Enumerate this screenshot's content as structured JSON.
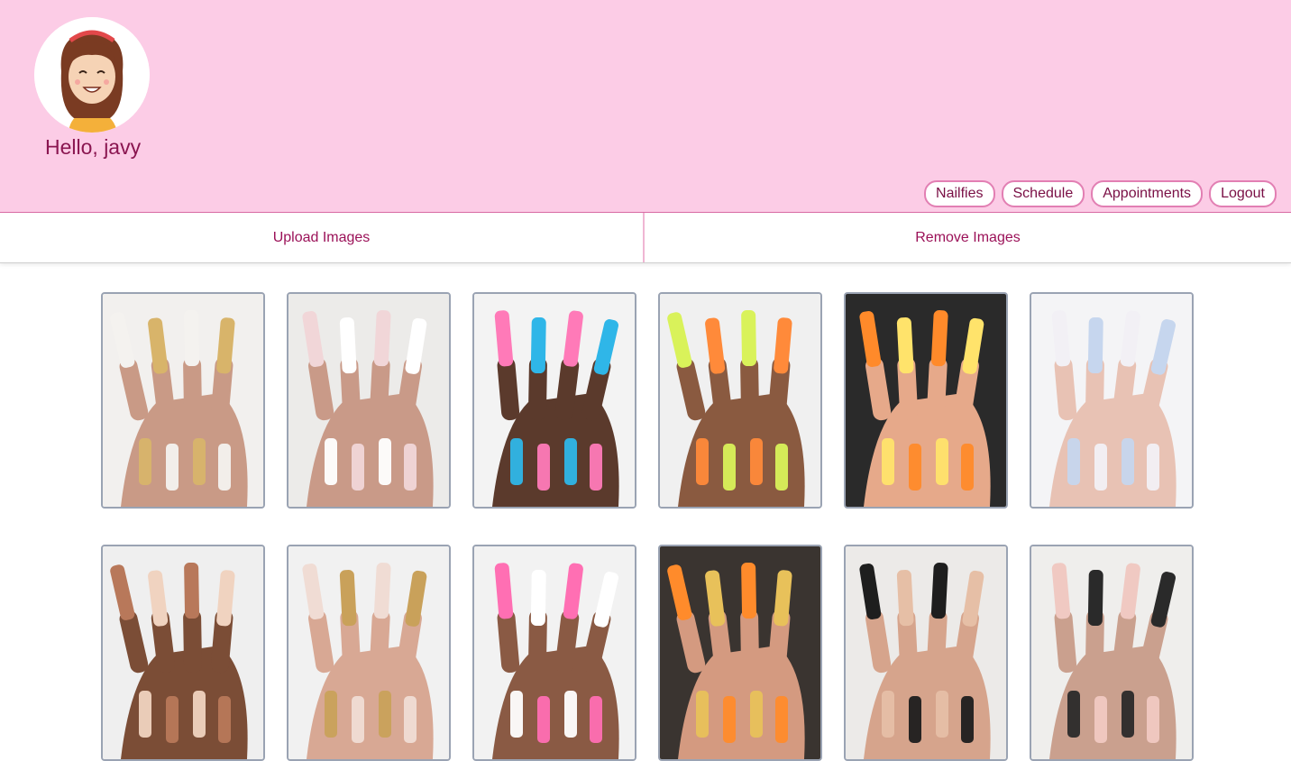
{
  "header": {
    "greeting": "Hello, javy",
    "bg_color": "#fccce6",
    "avatar_icon": "cartoon-girl-avatar"
  },
  "nav": {
    "items": [
      "Nailfies",
      "Schedule",
      "Appointments",
      "Logout"
    ]
  },
  "tabs": {
    "upload": "Upload Images",
    "remove": "Remove Images"
  },
  "gallery": {
    "photos": [
      {
        "bg": "#f2f0ee",
        "skin": "#c99a86",
        "nail": "#f4f2ef",
        "accent": "#d8b46a"
      },
      {
        "bg": "#ecebe9",
        "skin": "#c99a88",
        "nail": "#f1d6d8",
        "accent": "#ffffff"
      },
      {
        "bg": "#f3f3f3",
        "skin": "#5b3a2c",
        "nail": "#ff7ab8",
        "accent": "#2fb6e8"
      },
      {
        "bg": "#f0f0f0",
        "skin": "#8a5a40",
        "nail": "#d9f25a",
        "accent": "#ff8a3a"
      },
      {
        "bg": "#2a2a2a",
        "skin": "#e6a98a",
        "nail": "#ff8a2a",
        "accent": "#ffe36b"
      },
      {
        "bg": "#f4f4f6",
        "skin": "#e8c2b4",
        "nail": "#f2f0f5",
        "accent": "#c6d6ee"
      },
      {
        "bg": "#efefef",
        "skin": "#7b4d36",
        "nail": "#b8785a",
        "accent": "#f0d3c0"
      },
      {
        "bg": "#f1f1f1",
        "skin": "#d8a894",
        "nail": "#f0dcd4",
        "accent": "#c9a15a"
      },
      {
        "bg": "#f2f2f2",
        "skin": "#8a5a44",
        "nail": "#ff6fb3",
        "accent": "#ffffff"
      },
      {
        "bg": "#3a3430",
        "skin": "#d49a80",
        "nail": "#ff8b2b",
        "accent": "#e8c15a"
      },
      {
        "bg": "#eceae8",
        "skin": "#d6a48c",
        "nail": "#1e1e1e",
        "accent": "#e6bfa6"
      },
      {
        "bg": "#efeeec",
        "skin": "#caa08e",
        "nail": "#f0c9c2",
        "accent": "#2a2a2a"
      }
    ]
  }
}
